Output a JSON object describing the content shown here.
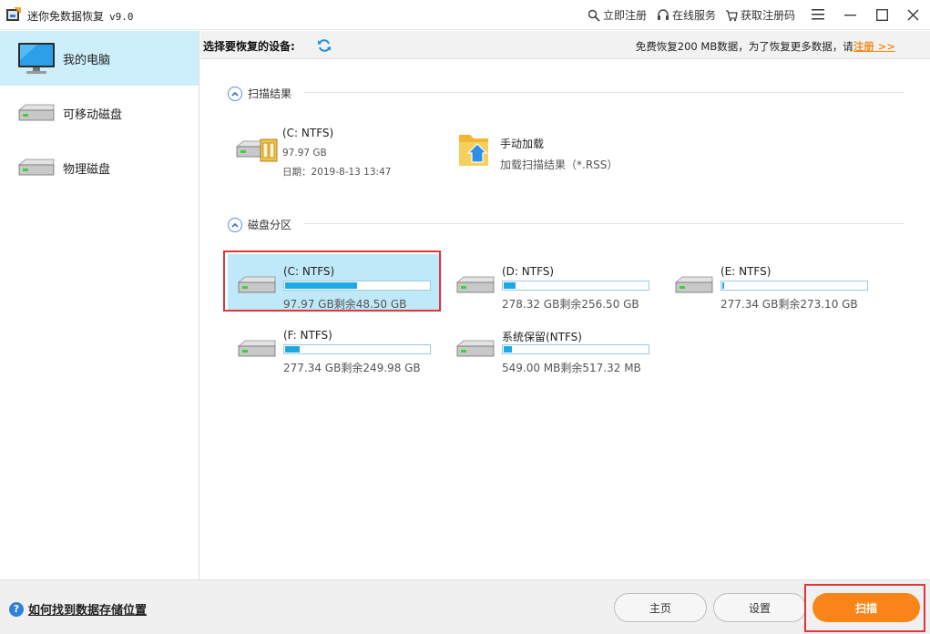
{
  "app": {
    "title": "迷你免数据恢复",
    "version": "v9.0"
  },
  "titlebar": {
    "register_now": "立即注册",
    "online_service": "在线服务",
    "get_code": "获取注册码"
  },
  "sidebar": {
    "items": [
      {
        "label": "我的电脑",
        "icon": "monitor-icon",
        "active": true
      },
      {
        "label": "可移动磁盘",
        "icon": "drive-icon",
        "active": false
      },
      {
        "label": "物理磁盘",
        "icon": "drive-icon",
        "active": false
      }
    ]
  },
  "toolbar": {
    "select_device": "选择要恢复的设备:",
    "promo_text": "免费恢复200 MB数据，为了恢复更多数据，请",
    "register_link": "注册 >>"
  },
  "scan_results": {
    "heading": "扫描结果",
    "item": {
      "name": "(C: NTFS)",
      "size": "97.97 GB",
      "date": "日期：2019-8-13 13:47"
    },
    "manual_load": {
      "title": "手动加载",
      "subtitle": "加载扫描结果（*.RSS）"
    }
  },
  "partitions": {
    "heading": "磁盘分区",
    "items": [
      {
        "name": "(C: NTFS)",
        "capacity": "97.97 GB剩余48.50 GB",
        "used_fraction": 0.5,
        "selected": true
      },
      {
        "name": "(D: NTFS)",
        "capacity": "278.32 GB剩余256.50 GB",
        "used_fraction": 0.08,
        "selected": false
      },
      {
        "name": "(E: NTFS)",
        "capacity": "277.34 GB剩余273.10 GB",
        "used_fraction": 0.015,
        "selected": false
      },
      {
        "name": "(F: NTFS)",
        "capacity": "277.34 GB剩余249.98 GB",
        "used_fraction": 0.1,
        "selected": false
      },
      {
        "name": "系统保留(NTFS)",
        "capacity": "549.00 MB剩余517.32 MB",
        "used_fraction": 0.06,
        "selected": false
      }
    ]
  },
  "footer": {
    "help": "如何找到数据存储位置",
    "home": "主页",
    "settings": "设置",
    "scan": "扫描"
  },
  "colors": {
    "accent_orange": "#f98518",
    "selection_blue": "#bfe8f9",
    "bar_blue": "#1fa9e2",
    "highlight_red": "#e0353b"
  }
}
